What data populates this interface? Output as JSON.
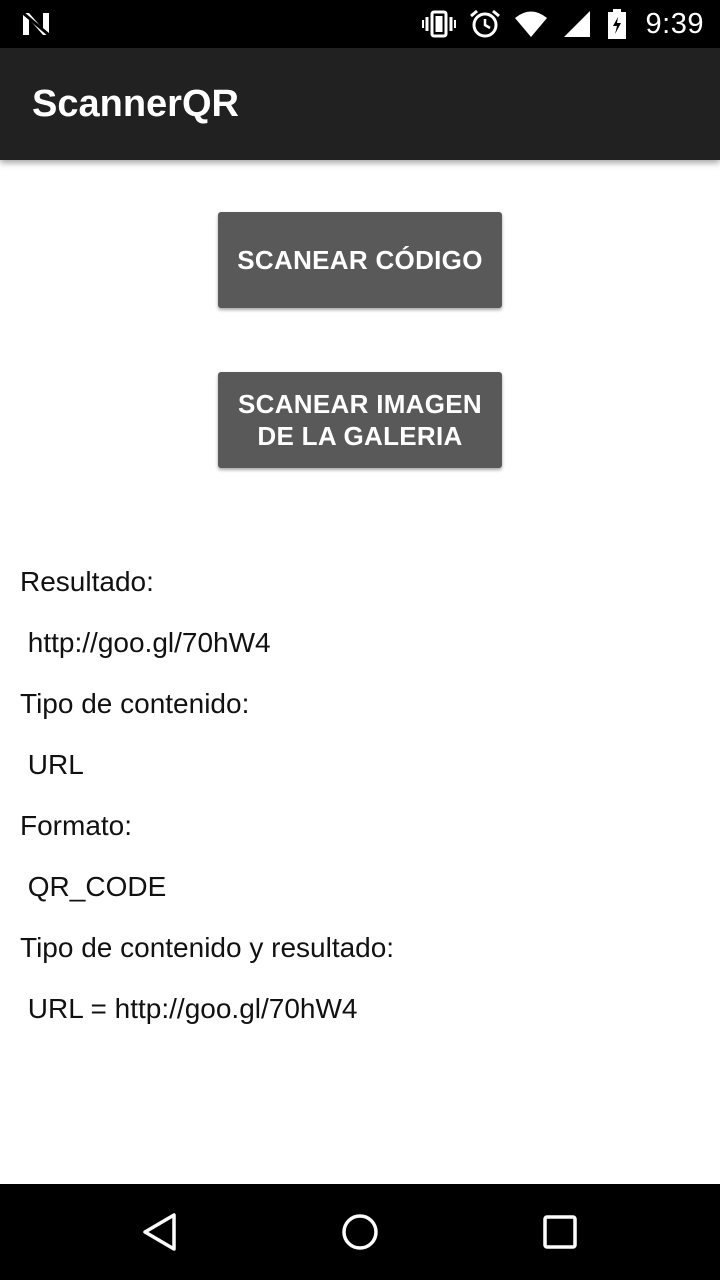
{
  "status_bar": {
    "time": "9:39",
    "icons": [
      "notification-n-icon",
      "vibrate-icon",
      "alarm-icon",
      "wifi-icon",
      "signal-icon",
      "battery-icon"
    ]
  },
  "app_bar": {
    "title": "ScannerQR"
  },
  "buttons": {
    "scan_code": "SCANEAR CÓDIGO",
    "scan_gallery_line1": "SCANEAR IMAGEN",
    "scan_gallery_line2": "DE LA GALERIA"
  },
  "results": {
    "result_label": "Resultado:",
    "result_value": " http://goo.gl/70hW4",
    "content_type_label": "Tipo de contenido:",
    "content_type_value": " URL",
    "format_label": "Formato:",
    "format_value": " QR_CODE",
    "type_and_result_label": "Tipo de contenido y resultado:",
    "type_and_result_value": " URL = http://goo.gl/70hW4"
  },
  "nav_bar": {
    "icons": [
      "back-icon",
      "home-icon",
      "recents-icon"
    ]
  },
  "colors": {
    "status_bar": "#000000",
    "app_bar": "#212121",
    "button": "#595959",
    "background": "#ffffff"
  }
}
